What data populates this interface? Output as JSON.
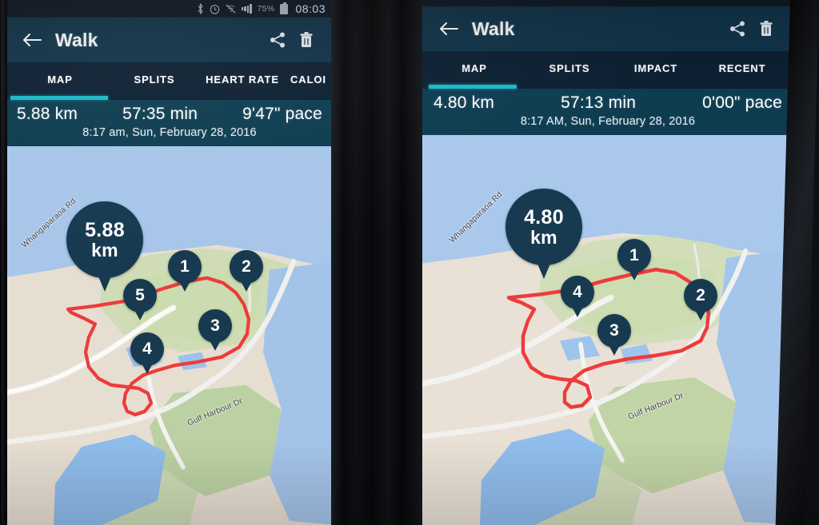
{
  "colors": {
    "appbar_bg": "#12354b",
    "tabs_bg": "#0d2033",
    "stats_bg": "#0d3c50",
    "tab_indicator": "#1bb8c4",
    "pin_navy": "#173a50",
    "route_red": "#ee3b3b",
    "water_blue": "#a7c6ea",
    "land_tan": "#e6ddd2",
    "land_green": "#c3d6a8"
  },
  "status_bar": {
    "bluetooth_icon": "bluetooth-icon",
    "alarm_icon": "alarm-clock-icon",
    "wifi_off_icon": "wifi-off-icon",
    "signal_icon": "signal-bars-icon",
    "battery_percent": "75%",
    "battery_icon": "battery-icon",
    "clock": "08:03"
  },
  "phone_left": {
    "appbar": {
      "back_icon": "back-arrow-icon",
      "title": "Walk",
      "share_icon": "share-icon",
      "delete_icon": "trash-icon"
    },
    "tabs": [
      {
        "label": "MAP",
        "active": true
      },
      {
        "label": "SPLITS",
        "active": false
      },
      {
        "label": "HEART RATE",
        "active": false
      },
      {
        "label": "CALOI",
        "active": false
      }
    ],
    "stats": {
      "distance": "5.88 km",
      "duration": "57:35 min",
      "pace": "9'47\" pace",
      "datetime": "8:17 am, Sun, February 28, 2016"
    },
    "map": {
      "total_label_value": "5.88",
      "total_label_unit": "km",
      "markers": [
        "1",
        "2",
        "3",
        "4",
        "5"
      ],
      "road_labels": [
        "Whangaparaoa Rd",
        "Gulf Harbour Dr"
      ]
    }
  },
  "phone_right": {
    "appbar": {
      "back_icon": "back-arrow-icon",
      "title": "Walk",
      "share_icon": "share-icon",
      "delete_icon": "trash-icon"
    },
    "tabs": [
      {
        "label": "MAP",
        "active": true
      },
      {
        "label": "SPLITS",
        "active": false
      },
      {
        "label": "IMPACT",
        "active": false
      },
      {
        "label": "RECENT",
        "active": false
      }
    ],
    "stats": {
      "distance": "4.80 km",
      "duration": "57:13 min",
      "pace": "0'00\" pace",
      "datetime": "8:17 AM, Sun, February 28, 2016"
    },
    "map": {
      "total_label_value": "4.80",
      "total_label_unit": "km",
      "markers": [
        "1",
        "2",
        "3",
        "4"
      ],
      "road_labels": [
        "Whangaparaoa Rd",
        "Gulf Harbour Dr"
      ]
    }
  }
}
